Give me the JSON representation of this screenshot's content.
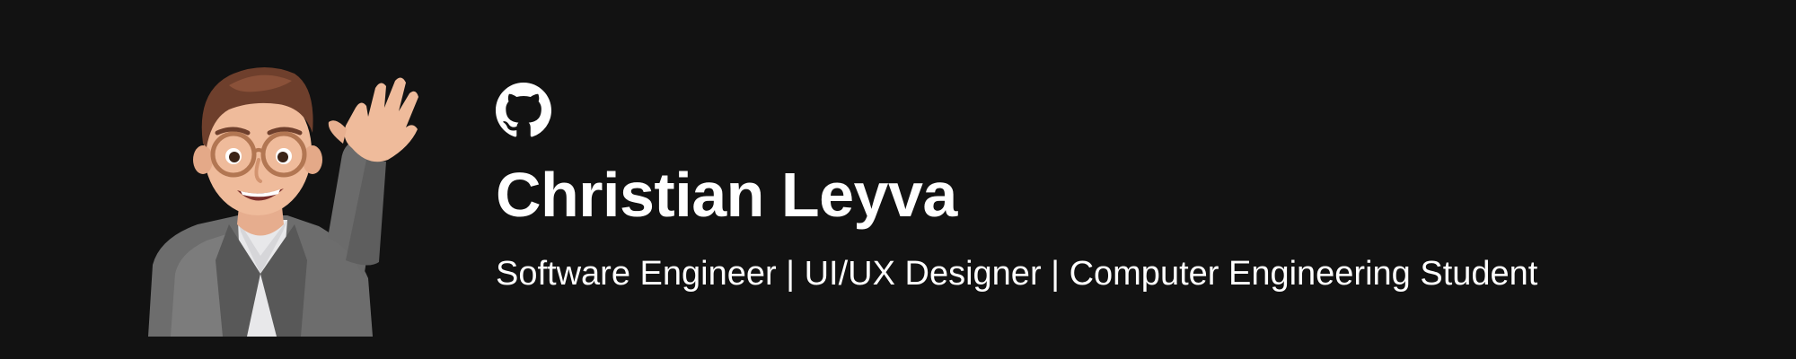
{
  "profile": {
    "name": "Christian Leyva",
    "tagline": "Software Engineer | UI/UX Designer | Computer Engineering Student",
    "avatar_icon": "waving-memoji-avatar",
    "github_icon": "github-icon"
  },
  "colors": {
    "background": "#121212",
    "text": "#ffffff"
  }
}
